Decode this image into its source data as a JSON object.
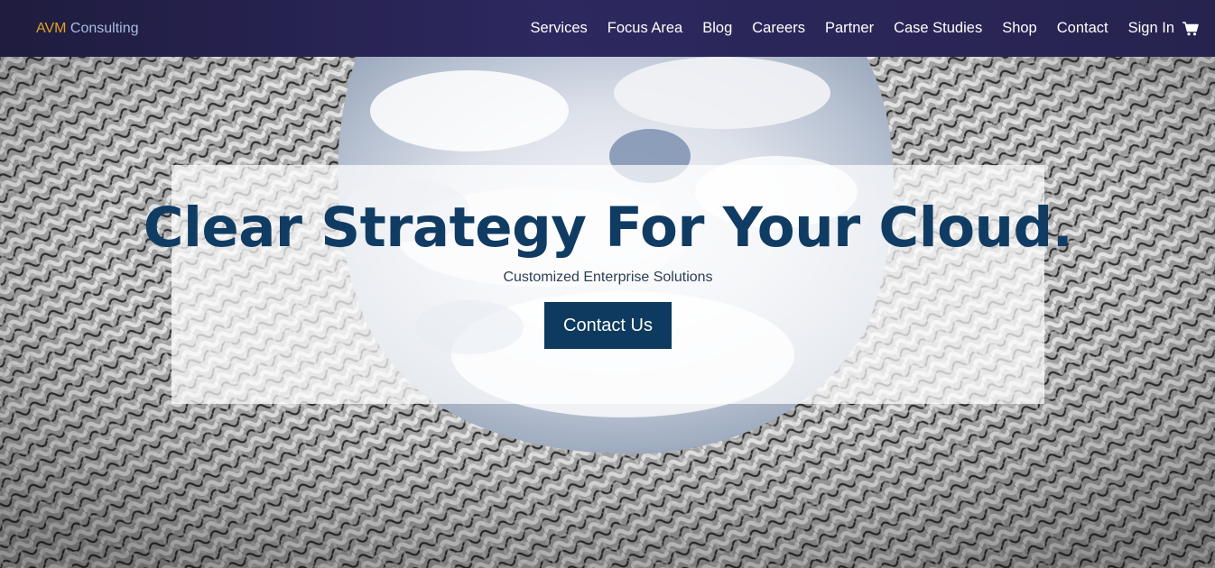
{
  "brand": {
    "part1": "AVM",
    "part2": " Consulting",
    "color_primary": "#e0a21f",
    "color_secondary": "#a9bde0"
  },
  "nav": {
    "items": [
      {
        "label": "Services"
      },
      {
        "label": "Focus Area"
      },
      {
        "label": "Blog"
      },
      {
        "label": "Careers"
      },
      {
        "label": "Partner"
      },
      {
        "label": "Case Studies"
      },
      {
        "label": "Shop"
      },
      {
        "label": "Contact"
      },
      {
        "label": "Sign In"
      }
    ],
    "cart_icon": "shopping-cart-icon"
  },
  "hero": {
    "title": "Clear Strategy For Your Cloud.",
    "subtitle": "Customized Enterprise Solutions",
    "cta_label": "Contact Us",
    "background_image": "architectural-lattice-with-cloudy-sky"
  },
  "colors": {
    "navbar": "#2a2558",
    "title": "#103c63",
    "button": "#0d3a5e"
  }
}
